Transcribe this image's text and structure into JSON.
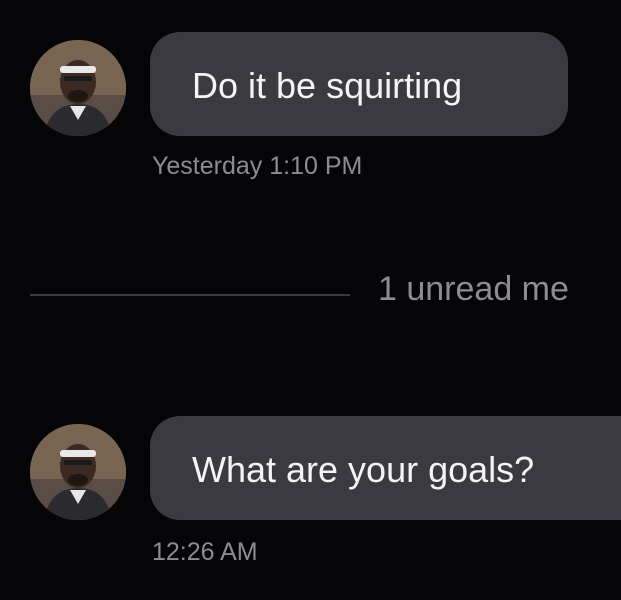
{
  "conversation": {
    "messages": [
      {
        "text": "Do it be squirting",
        "timestamp": "Yesterday 1:10 PM",
        "avatar_icon": "user-avatar-photo"
      },
      {
        "text": "What are your goals?",
        "timestamp": "12:26 AM",
        "avatar_icon": "user-avatar-photo"
      }
    ],
    "unread_divider": {
      "label": "1 unread me"
    }
  },
  "colors": {
    "background": "#050507",
    "bubble": "#3a3a40",
    "bubble_text": "#f4f4f6",
    "meta_text": "#8c8c92"
  }
}
